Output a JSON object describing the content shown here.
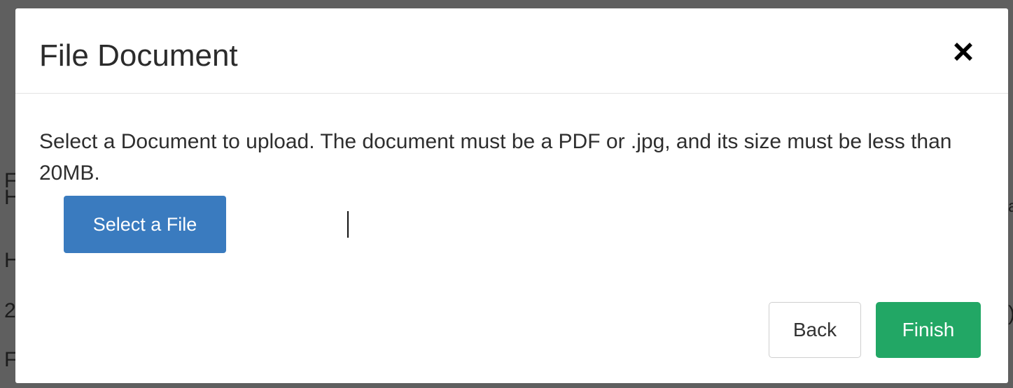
{
  "dialog": {
    "title": "File Document",
    "close_icon": "close-icon",
    "instructions": "Select a Document to upload. The document must be a PDF or .jpg, and its size must be less than 20MB.",
    "select_file_label": "Select a File",
    "back_label": "Back",
    "finish_label": "Finish"
  },
  "background": {
    "glyphs": [
      "(",
      "F",
      "H",
      "H",
      "2",
      "F",
      "a",
      ")"
    ]
  },
  "colors": {
    "primary_button": "#3a7bbf",
    "finish_button": "#22a765",
    "backdrop": "#5f5f5f"
  }
}
